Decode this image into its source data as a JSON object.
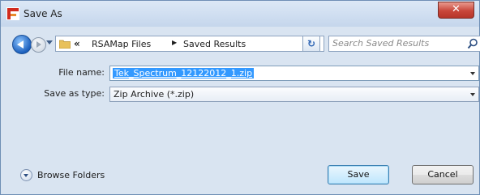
{
  "window": {
    "title": "Save As",
    "close_glyph": "✕"
  },
  "nav": {
    "crumbs": [
      "RSAMap Files",
      "Saved Results"
    ],
    "overflow": "«",
    "separator": "▶",
    "refresh_glyph": "↻",
    "search_placeholder": "Search Saved Results"
  },
  "form": {
    "file_name_label": "File name:",
    "file_name_value": "Tek_Spectrum_12122012_1.zip",
    "save_type_label": "Save as type:",
    "save_type_value": "Zip Archive (*.zip)"
  },
  "footer": {
    "browse_label": "Browse Folders",
    "save_label": "Save",
    "cancel_label": "Cancel"
  },
  "colors": {
    "accent": "#3399ff",
    "title_bg": "#dce8f6",
    "close": "#c8463a"
  }
}
